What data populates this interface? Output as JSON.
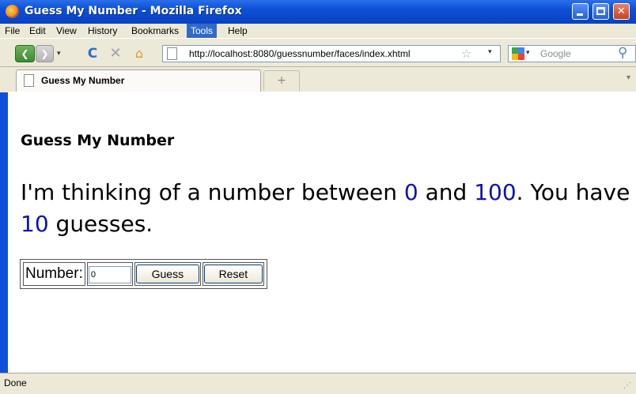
{
  "window": {
    "title": "Guess My Number - Mozilla Firefox",
    "min_glyph": "",
    "close_glyph": "✕"
  },
  "menu": {
    "items": [
      "File",
      "Edit",
      "View",
      "History",
      "Bookmarks",
      "Tools",
      "Help"
    ],
    "active": "Tools"
  },
  "nav": {
    "back_glyph": "❮",
    "forward_glyph": "❯",
    "dropdown_glyph": "▾",
    "reload_glyph": "C",
    "stop_glyph": "✕",
    "home_glyph": "⌂",
    "url": "http://localhost:8080/guessnumber/faces/index.xhtml",
    "star_glyph": "☆",
    "search_engine": "Google",
    "search_placeholder": "Google",
    "search_glyph": "⚲"
  },
  "tabs": {
    "active_label": "Guess My Number",
    "new_tab_glyph": "+",
    "scroll_glyph": "▾"
  },
  "page": {
    "heading": "Guess My Number",
    "intro_part1": "I'm thinking of a number between ",
    "min_value": "0",
    "intro_part2": " and ",
    "max_value": "100",
    "intro_part3": ". You have ",
    "guesses": "10",
    "intro_part4": " guesses."
  },
  "form": {
    "number_label": "Number:",
    "number_value": "0",
    "guess_button": "Guess",
    "reset_button": "Reset"
  },
  "status": {
    "text": "Done",
    "grip_glyph": "⋰"
  },
  "icons": [
    "firefox-icon",
    "minimize-icon",
    "maximize-icon",
    "close-icon",
    "back-icon",
    "forward-icon",
    "reload-icon",
    "stop-icon",
    "home-icon",
    "page-icon",
    "bookmark-star-icon",
    "search-engine-icon",
    "search-icon",
    "new-tab-icon"
  ],
  "colors": {
    "titlebar": "#0b4fd6",
    "chrome": "#ece9d8",
    "number_highlight": "#1111b3",
    "menu_active": "#316ac5"
  }
}
